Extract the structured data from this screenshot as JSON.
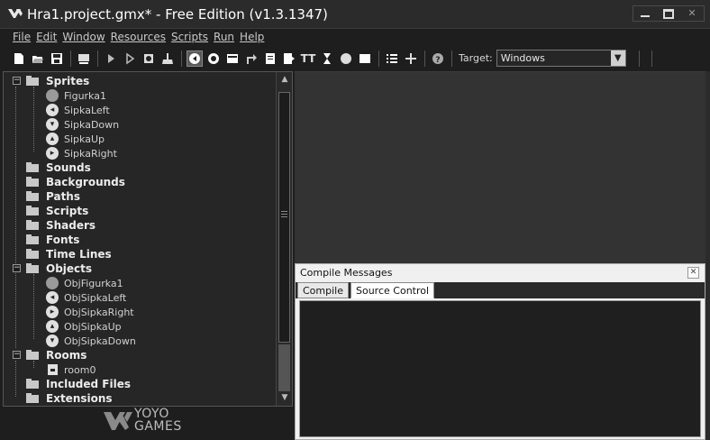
{
  "window": {
    "title": "Hra1.project.gmx*  -  Free Edition (v1.3.1347)",
    "icon": "yoyo-logo-icon",
    "buttons": {
      "minimize": "",
      "maximize": "",
      "close": "✕"
    }
  },
  "menu": [
    "File",
    "Edit",
    "Window",
    "Resources",
    "Scripts",
    "Run",
    "Help"
  ],
  "toolbar": {
    "target_label": "Target:",
    "target_value": "Windows",
    "dropdown_arrow": "▼"
  },
  "tree": {
    "sprites": {
      "label": "Sprites",
      "expander": "−",
      "items": [
        "Figurka1",
        "SipkaLeft",
        "SipkaDown",
        "SipkaUp",
        "SipkaRight"
      ]
    },
    "sounds": "Sounds",
    "backgrounds": "Backgrounds",
    "paths": "Paths",
    "scripts": "Scripts",
    "shaders": "Shaders",
    "fonts": "Fonts",
    "timelines": "Time Lines",
    "objects": {
      "label": "Objects",
      "expander": "−",
      "items": [
        "ObjFigurka1",
        "ObjSipkaLeft",
        "ObjSipkaRight",
        "ObjSipkaUp",
        "ObjSipkaDown"
      ]
    },
    "rooms": {
      "label": "Rooms",
      "expander": "−",
      "items": [
        "room0"
      ]
    },
    "included_files": "Included Files",
    "extensions": "Extensions"
  },
  "logo": {
    "line1": "YOYO",
    "line2": "GAMES"
  },
  "compile_panel": {
    "title": "Compile Messages",
    "close_glyph": "✕",
    "tabs": [
      "Compile",
      "Source Control"
    ],
    "selected_tab": "Source Control"
  },
  "colors": {
    "background": "#1e1e1e",
    "workspace": "#333333",
    "panel_light": "#f0f0f0"
  }
}
